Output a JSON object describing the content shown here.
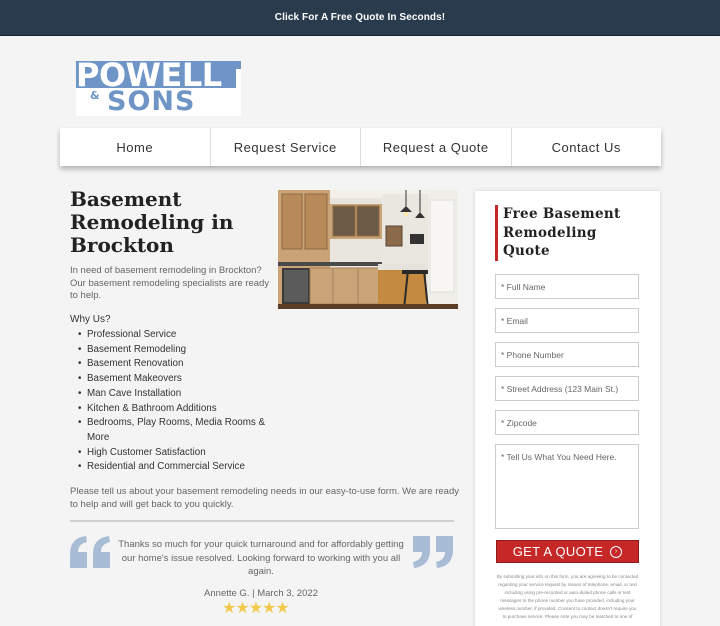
{
  "topbar": {
    "cta": "Click For A Free Quote In Seconds!"
  },
  "logo": {
    "line1": "POWELL",
    "amp": "&",
    "line2": "SONS"
  },
  "nav": {
    "items": [
      {
        "label": "Home"
      },
      {
        "label": "Request Service"
      },
      {
        "label": "Request a Quote"
      },
      {
        "label": "Contact Us"
      }
    ]
  },
  "main": {
    "title": "Basement Remodeling in Brockton",
    "intro": "In need of basement remodeling in Brockton? Our basement remodeling specialists are ready to help.",
    "why_label": "Why Us?",
    "bullets": [
      "Professional Service",
      "Basement Remodeling",
      "Basement Renovation",
      "Basement Makeovers",
      "Man Cave Installation",
      "Kitchen & Bathroom Additions",
      "Bedrooms, Play Rooms, Media Rooms & More",
      "High Customer Satisfaction",
      "Residential and Commercial Service"
    ],
    "outro": "Please tell us about your basement remodeling needs in our easy-to-use form. We are ready to help and will get back to you quickly."
  },
  "testimonial": {
    "quote": "Thanks so much for your quick turnaround and for affordably getting our home's issue resolved. Looking forward to working with you all again.",
    "author": "Annette G. | March 3, 2022",
    "rating": 5,
    "stars": "★★★★★"
  },
  "form": {
    "title": "Free Basement Remodeling Quote",
    "fields": {
      "full_name": "* Full Name",
      "email": "* Email",
      "phone": "* Phone Number",
      "address": "* Street Address (123 Main St.)",
      "zipcode": "* Zipcode",
      "message": "* Tell Us What You Need Here."
    },
    "submit_label": "GET A QUOTE",
    "submit_arrow": "›",
    "disclaimer": "By submitting your info on this form, you are agreeing to be contacted regarding your service request by means of telephone, email, or text including using pre-recorded or auto-dialed phone calls or text messages to the phone number you have provided, including your wireless number, if provided. Consent to contact doesn't require you to purchase service. Please note you may be matched to one of"
  },
  "colors": {
    "topbar": "#2b3b4e",
    "logo_blue": "#6f94c6",
    "accent_red": "#c62828",
    "star_gold": "#f2c94c",
    "quote_mark": "#a9bcd6"
  }
}
